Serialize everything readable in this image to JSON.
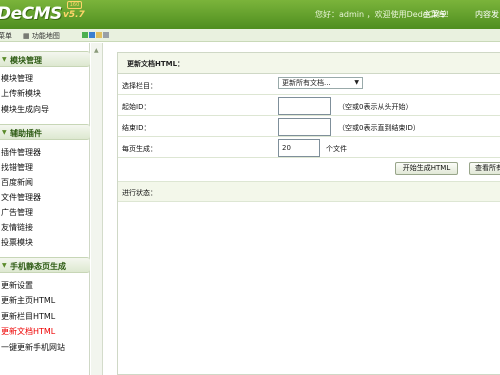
{
  "header": {
    "logo": "DeCMS",
    "version": "v5.7",
    "version_badge": "160",
    "welcome": "您好：admin ，欢迎使用DedeCMS！",
    "main_menu": "主菜单",
    "content_nav": "内容发"
  },
  "subbar": {
    "menu_label": "菜单",
    "sitemap_label": "功能地图",
    "swatches": [
      "#4caf50",
      "#3a7fd0",
      "#e0c060",
      "#9aa0a6"
    ]
  },
  "sidebar": {
    "sections": [
      {
        "title": "模块管理",
        "items": [
          "模块管理",
          "上传新模块",
          "模块生成向导"
        ]
      },
      {
        "title": "辅助插件",
        "items": [
          "插件管理器",
          "找错管理",
          "百度新闻",
          "文件管理器",
          "广告管理",
          "友情链接",
          "投票模块"
        ]
      },
      {
        "title": "手机静态页生成",
        "items": [
          "更新设置",
          "更新主页HTML",
          "更新栏目HTML",
          "更新文档HTML",
          "一键更新手机网站"
        ]
      }
    ],
    "active_item": "更新文档HTML"
  },
  "form": {
    "title": "更新文档HTML：",
    "column_label": "选择栏目：",
    "column_value": "更新所有文档...",
    "start_label": "起始ID：",
    "start_value": "",
    "start_hint": "（空或0表示从头开始）",
    "end_label": "结束ID：",
    "end_value": "",
    "end_hint": "（空或0表示直到结束ID）",
    "per_page_label": "每页生成：",
    "per_page_value": "20",
    "per_page_unit": "个文件",
    "generate_button": "开始生成HTML",
    "view_all_button": "查看所有",
    "progress_label": "进行状态："
  }
}
